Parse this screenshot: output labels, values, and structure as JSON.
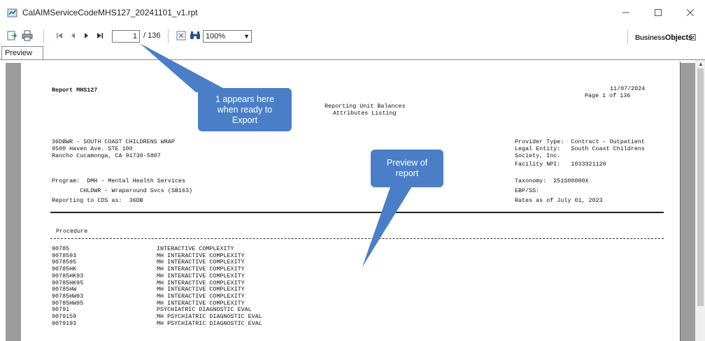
{
  "window": {
    "title": "CalAIMServiceCodeMHS127_20241101_v1.rpt",
    "minimize_icon": "minimize-icon",
    "maximize_icon": "maximize-icon",
    "close_icon": "close-icon"
  },
  "toolbar": {
    "export_icon": "export-icon",
    "print_icon": "printer-icon",
    "first_page_icon": "first-page-icon",
    "prev_page_icon": "previous-page-icon",
    "next_page_icon": "next-page-icon",
    "last_page_icon": "last-page-icon",
    "current_page": "1",
    "total_pages": "/ 136",
    "stop_icon": "stop-icon",
    "search_icon": "binoculars-icon",
    "zoom": "100%",
    "brand_prefix": "Business",
    "brand_suffix": "Objects"
  },
  "tabs": [
    {
      "label": "Preview"
    }
  ],
  "report": {
    "name": "Report MHS127",
    "date": "11/07/2024",
    "page_of": "Page 1 of 136",
    "title_line1": "Reporting Unit Balances",
    "title_line2": "Attributes Listing",
    "address_line1": "36DBWR - SOUTH COAST CHILDRENS WRAP",
    "address_line2": "9500 Haven Ave. STE 100",
    "address_line3": "Rancho Cucamonga, CA 91730-5807",
    "provider_type": "Provider Type:  Contract - Outpatient",
    "legal_entity": "Legal Entity:   South Coast Childrens",
    "legal_entity_cont": "Society, Inc.",
    "facility_npi": "Facility NPI:   1033321120",
    "program_line1": "Program:  DMH - Mental Health Services",
    "program_line2": "        CHLDWR - Wraparound Svcs (SB163)",
    "reporting_to": "Reporting to CDS as:  36DB",
    "taxonomy": "Taxonomy:  251S00000X",
    "ebp": "EBP/SS:",
    "rates": "Rates as of July 01, 2023",
    "procedure_header": "Procedure",
    "procedures": [
      {
        "code": "90785",
        "desc": "INTERACTIVE COMPLEXITY"
      },
      {
        "code": "9078593",
        "desc": "MH INTERACTIVE COMPLEXITY"
      },
      {
        "code": "9078595",
        "desc": "MH INTERACTIVE COMPLEXITY"
      },
      {
        "code": "90785HK",
        "desc": "MH INTERACTIVE COMPLEXITY"
      },
      {
        "code": "90785HK93",
        "desc": "MH INTERACTIVE COMPLEXITY"
      },
      {
        "code": "90785HK95",
        "desc": "MH INTERACTIVE COMPLEXITY"
      },
      {
        "code": "90785HW",
        "desc": "MH INTERACTIVE COMPLEXITY"
      },
      {
        "code": "90785HW93",
        "desc": "MH INTERACTIVE COMPLEXITY"
      },
      {
        "code": "90785HW95",
        "desc": "MH INTERACTIVE COMPLEXITY"
      },
      {
        "code": "90791",
        "desc": "PSYCHIATRIC DIAGNOSTIC EVAL"
      },
      {
        "code": "9079159",
        "desc": "MH PSYCHIATRIC DIAGNOSTIC EVAL"
      },
      {
        "code": "9079193",
        "desc": "MH PSYCHIATRIC DIAGNOSTIC EVAL"
      }
    ]
  },
  "callouts": {
    "export_note": [
      "1 appears here",
      "when ready to",
      "Export"
    ],
    "preview_note": [
      "Preview of",
      "report"
    ],
    "color": "#4a7fc8"
  }
}
